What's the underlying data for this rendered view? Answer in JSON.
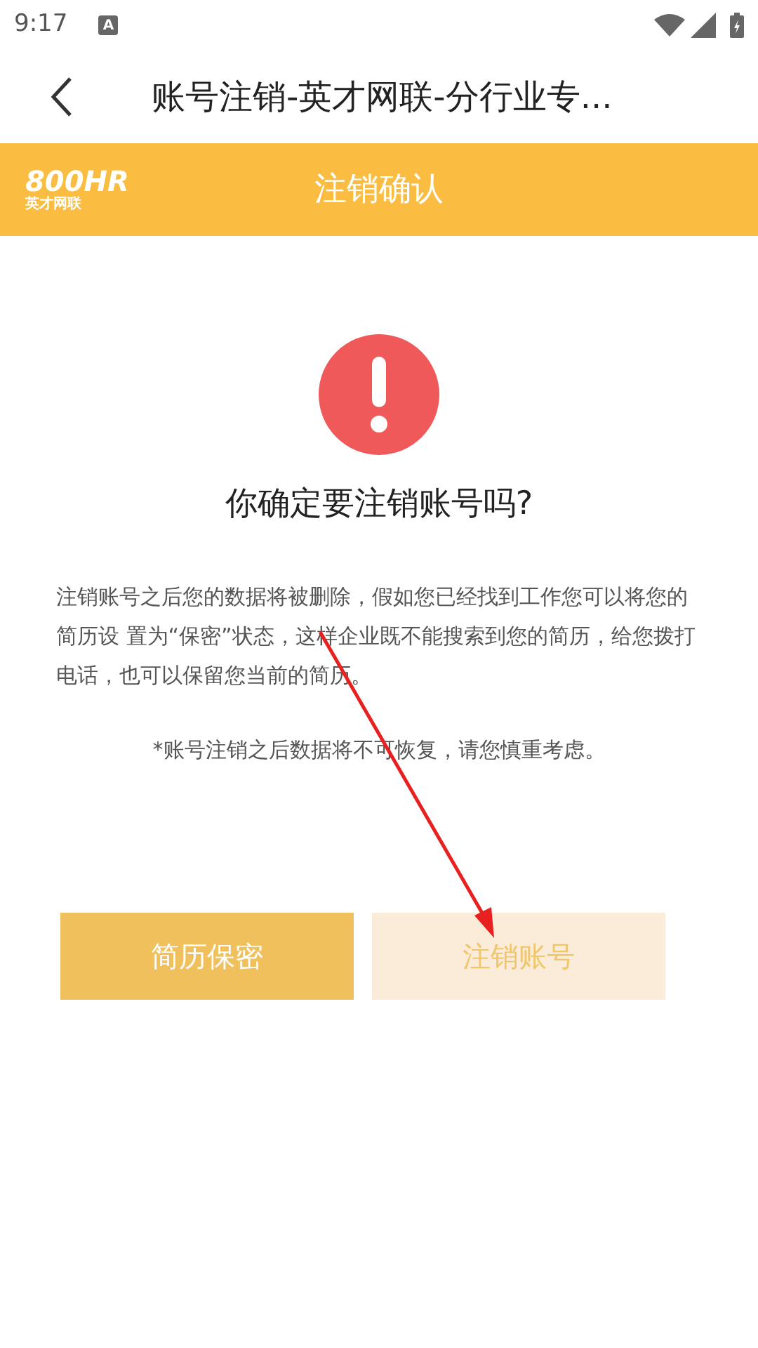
{
  "status_bar": {
    "time": "9:17",
    "notification": "A"
  },
  "title_bar": {
    "title": "账号注销-英才网联-分行业专..."
  },
  "header": {
    "logo_mark": "800HR",
    "logo_name": "英才网联",
    "title": "注销确认"
  },
  "dialog": {
    "question": "你确定要注销账号吗?",
    "message": "注销账号之后您的数据将被删除，假如您已经找到工作您可以将您的简历设 置为“保密”状态，这样企业既不能搜索到您的简历，给您拨打电话，也可以保留您当前的简历。",
    "note": "*账号注销之后数据将不可恢复，请您慎重考虑。"
  },
  "buttons": [
    {
      "label": "简历保密",
      "kind": "primary"
    },
    {
      "label": "注销账号",
      "kind": "muted"
    }
  ]
}
